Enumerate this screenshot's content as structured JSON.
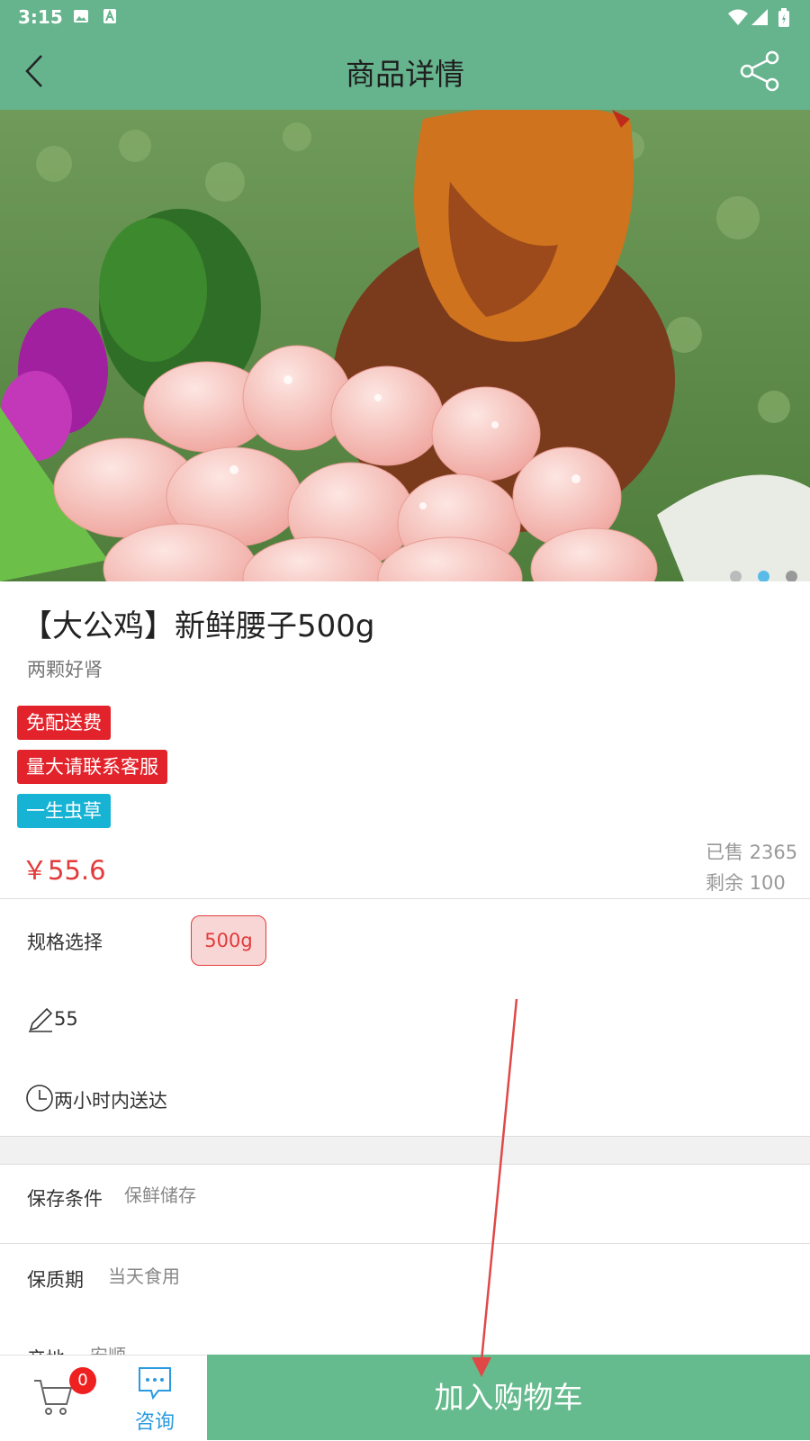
{
  "status_bar": {
    "time": "3:15"
  },
  "app_bar": {
    "title": "商品详情"
  },
  "gallery": {
    "dot_count": 3,
    "active_dot": 2,
    "image_alt": "大公鸡 鲜腰子"
  },
  "product": {
    "name": "【大公鸡】新鲜腰子500g",
    "subtitle": "两颗好肾",
    "tags": [
      {
        "label": "免配送费",
        "color": "#e3232b"
      },
      {
        "label": "量大请联系客服",
        "color": "#e3232b"
      },
      {
        "label": "一生虫草",
        "color": "#17b3d4"
      }
    ],
    "price": "￥55.6",
    "sold": "已售  2365",
    "remaining": "剩余  100"
  },
  "spec": {
    "label": "规格选择",
    "selected_option": "500g",
    "stock_value": "55",
    "delivery_note": "两小时内送达"
  },
  "info": {
    "storage_label": "保存条件",
    "storage_value": "保鲜储存",
    "shelf_label": "保质期",
    "shelf_value": "当天食用",
    "origin_label": "产地",
    "origin_value": "安顺"
  },
  "bottom_bar": {
    "cart_count": "0",
    "consult_label": "咨询",
    "add_to_cart_label": "加入购物车"
  },
  "colors": {
    "accent": "#66b48e",
    "price": "#e23a3a",
    "arrow": "#e04848"
  }
}
